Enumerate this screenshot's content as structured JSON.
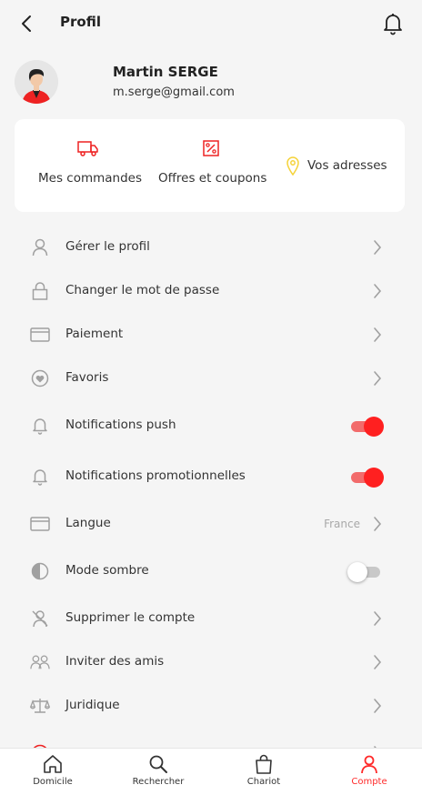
{
  "header": {
    "title": "Profil"
  },
  "user": {
    "name": "Martin SERGE",
    "email": "m.serge@gmail.com"
  },
  "quick_actions": {
    "orders": "Mes commandes",
    "offers": "Offres et coupons",
    "addresses": "Vos adresses"
  },
  "menu": {
    "items": [
      {
        "label": "Gérer le profil",
        "icon": "user-icon"
      },
      {
        "label": "Changer le mot de passe",
        "icon": "lock-icon"
      },
      {
        "label": "Paiement",
        "icon": "card-icon"
      },
      {
        "label": "Favoris",
        "icon": "heart-icon"
      },
      {
        "label": "Notifications push",
        "icon": "bell-icon",
        "toggle": true
      },
      {
        "label": "Notifications promotionnelles",
        "icon": "bell-icon",
        "toggle": true
      },
      {
        "label": "Langue",
        "icon": "card-icon",
        "value": "France"
      },
      {
        "label": "Mode sombre",
        "icon": "contrast-icon",
        "toggle": false
      },
      {
        "label": "Supprimer le compte",
        "icon": "user-remove-icon"
      },
      {
        "label": "Inviter des amis",
        "icon": "users-icon"
      },
      {
        "label": "Juridique",
        "icon": "scale-icon"
      }
    ]
  },
  "bottom_nav": {
    "items": [
      {
        "label": "Domicile",
        "icon": "home-icon"
      },
      {
        "label": "Rechercher",
        "icon": "search-icon"
      },
      {
        "label": "Chariot",
        "icon": "bag-icon"
      },
      {
        "label": "Compte",
        "icon": "user-icon",
        "active": true
      }
    ]
  },
  "colors": {
    "accent": "#ff2020",
    "toggle_track_on": "#f26b6b",
    "pin": "#f5d33a",
    "icon_grey": "#a0a0a0"
  }
}
